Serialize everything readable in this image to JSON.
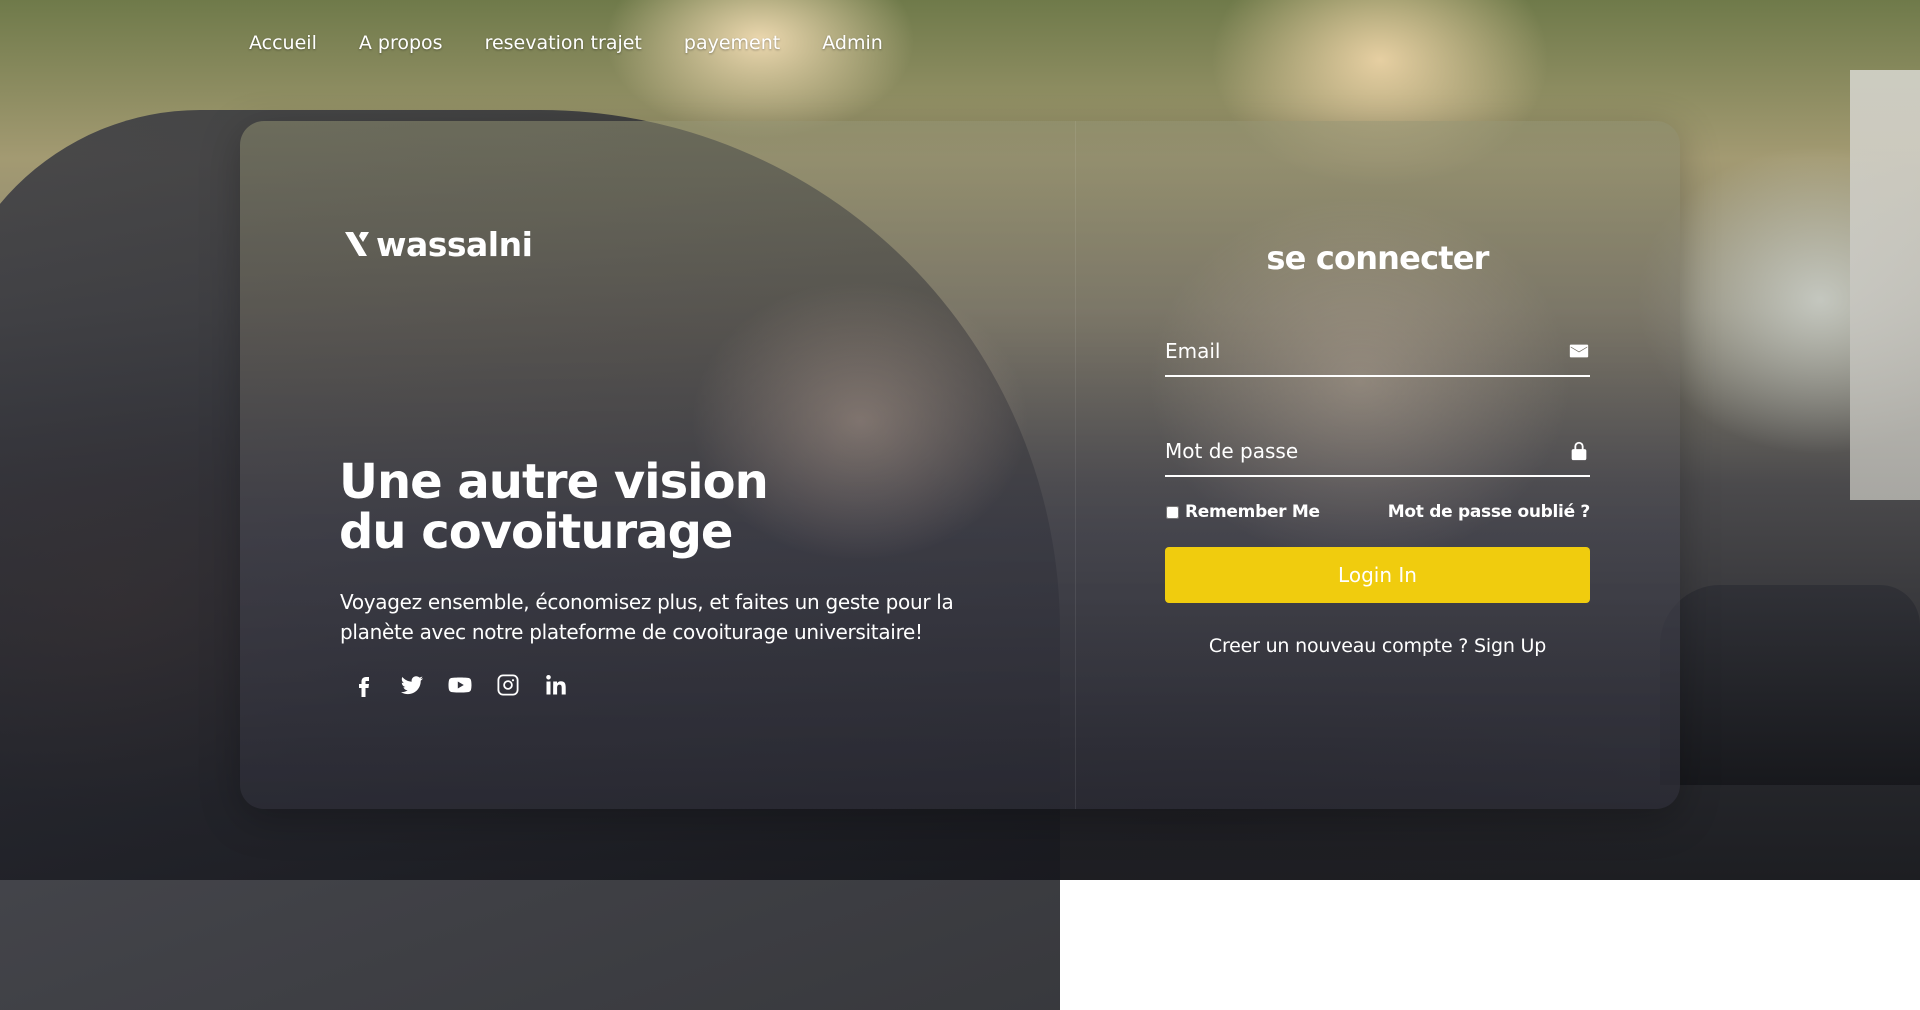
{
  "nav": {
    "items": [
      {
        "label": "Accueil"
      },
      {
        "label": "A propos"
      },
      {
        "label": "resevation trajet"
      },
      {
        "label": "payement"
      },
      {
        "label": "Admin"
      }
    ]
  },
  "brand": {
    "logo_text": "wassalni"
  },
  "hero": {
    "headline_line1": "Une autre vision",
    "headline_line2": "du covoiturage",
    "tagline": "Voyagez ensemble, économisez plus, et faites un geste pour la planète avec notre plateforme de covoiturage universitaire!"
  },
  "socials": {
    "icons": [
      "facebook-icon",
      "twitter-icon",
      "youtube-icon",
      "instagram-icon",
      "linkedin-icon"
    ]
  },
  "login": {
    "title": "se connecter",
    "email_placeholder": "Email",
    "email_icon": "mail-icon",
    "password_placeholder": "Mot de passe",
    "password_icon": "lock-icon",
    "remember_label": "Remember Me",
    "forgot_label": "Mot de passe oublié ?",
    "submit_label": "Login In",
    "signup_prompt": "Creer un nouveau compte ?",
    "signup_link": "Sign Up"
  },
  "colors": {
    "accent": "#f0cc0e",
    "text": "#ffffff"
  }
}
